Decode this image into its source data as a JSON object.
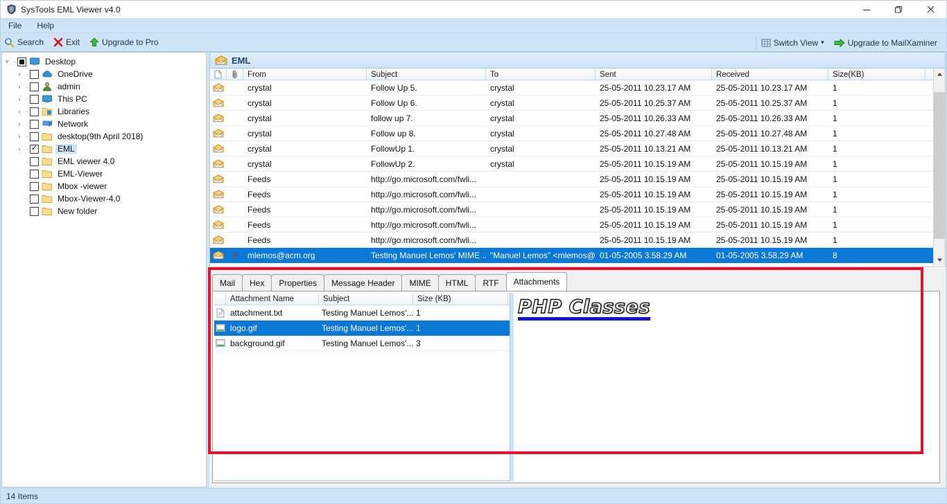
{
  "window": {
    "title": "SysTools EML Viewer v4.0",
    "app_icon": "shield-icon",
    "minimize": "—",
    "maximize": "❐",
    "close": "✕"
  },
  "menubar": {
    "items": [
      {
        "label": "File"
      },
      {
        "label": "Help"
      }
    ]
  },
  "toolbar": {
    "left": [
      {
        "label": "Search",
        "icon": "search-icon"
      },
      {
        "label": "Exit",
        "icon": "close-x-icon"
      },
      {
        "label": "Upgrade to Pro",
        "icon": "green-up-arrow-icon"
      }
    ],
    "right": [
      {
        "label": "Switch View",
        "icon": "grid-icon",
        "caret": "▾"
      },
      {
        "label": "Upgrade to MailXaminer",
        "icon": "green-right-arrow-icon"
      }
    ]
  },
  "sidebar": {
    "items": [
      {
        "label": "Desktop",
        "indent": 0,
        "twist": "˅",
        "check": "square",
        "icon": "monitor-icon",
        "selected": false
      },
      {
        "label": "OneDrive",
        "indent": 1,
        "twist": "›",
        "check": "empty",
        "icon": "cloud-icon",
        "selected": false
      },
      {
        "label": "admin",
        "indent": 1,
        "twist": "›",
        "check": "empty",
        "icon": "user-icon",
        "selected": false
      },
      {
        "label": "This PC",
        "indent": 1,
        "twist": "›",
        "check": "empty",
        "icon": "monitor-icon",
        "selected": false
      },
      {
        "label": "Libraries",
        "indent": 1,
        "twist": "›",
        "check": "empty",
        "icon": "library-icon",
        "selected": false
      },
      {
        "label": "Network",
        "indent": 1,
        "twist": "›",
        "check": "empty",
        "icon": "network-icon",
        "selected": false
      },
      {
        "label": "desktop(9th April 2018)",
        "indent": 1,
        "twist": "›",
        "check": "empty",
        "icon": "folder-icon",
        "selected": false
      },
      {
        "label": "EML",
        "indent": 1,
        "twist": "›",
        "check": "checked",
        "icon": "folder-icon",
        "selected": true
      },
      {
        "label": "EML viewer 4.0",
        "indent": 1,
        "twist": "",
        "check": "empty",
        "icon": "folder-icon",
        "selected": false
      },
      {
        "label": "EML-Viewer",
        "indent": 1,
        "twist": "",
        "check": "empty",
        "icon": "folder-icon",
        "selected": false
      },
      {
        "label": "Mbox -viewer",
        "indent": 1,
        "twist": "",
        "check": "empty",
        "icon": "folder-icon",
        "selected": false
      },
      {
        "label": "Mbox-Viewer-4.0",
        "indent": 1,
        "twist": "",
        "check": "empty",
        "icon": "folder-icon",
        "selected": false
      },
      {
        "label": "New folder",
        "indent": 1,
        "twist": "",
        "check": "empty",
        "icon": "folder-icon",
        "selected": false
      }
    ]
  },
  "folder_header": {
    "title": "EML",
    "icon": "mail-folder-icon"
  },
  "message_list": {
    "columns": [
      {
        "key": "icon",
        "label": ""
      },
      {
        "key": "clip",
        "label": ""
      },
      {
        "key": "from",
        "label": "From"
      },
      {
        "key": "subject",
        "label": "Subject"
      },
      {
        "key": "to",
        "label": "To"
      },
      {
        "key": "sent",
        "label": "Sent"
      },
      {
        "key": "received",
        "label": "Received"
      },
      {
        "key": "size",
        "label": "Size(KB)"
      }
    ],
    "rows": [
      {
        "from": "crystal",
        "subject": "Follow Up 5.",
        "to": "crystal",
        "sent": "25-05-2011 10.23.17 AM",
        "received": "25-05-2011 10.23.17 AM",
        "size": "1",
        "attachment": false,
        "selected": false
      },
      {
        "from": "crystal",
        "subject": "Follow Up 6.",
        "to": "crystal",
        "sent": "25-05-2011 10.25.37 AM",
        "received": "25-05-2011 10.25.37 AM",
        "size": "1",
        "attachment": false,
        "selected": false
      },
      {
        "from": "crystal",
        "subject": "follow up 7.",
        "to": "crystal",
        "sent": "25-05-2011 10.26.33 AM",
        "received": "25-05-2011 10.26.33 AM",
        "size": "1",
        "attachment": false,
        "selected": false
      },
      {
        "from": "crystal",
        "subject": "Follow up 8.",
        "to": "crystal",
        "sent": "25-05-2011 10.27.48 AM",
        "received": "25-05-2011 10.27.48 AM",
        "size": "1",
        "attachment": false,
        "selected": false
      },
      {
        "from": "crystal",
        "subject": "FollowUp 1.",
        "to": "crystal",
        "sent": "25-05-2011 10.13.21 AM",
        "received": "25-05-2011 10.13.21 AM",
        "size": "1",
        "attachment": false,
        "selected": false
      },
      {
        "from": "crystal",
        "subject": "FollowUp 2.",
        "to": "crystal",
        "sent": "25-05-2011 10.15.19 AM",
        "received": "25-05-2011 10.15.19 AM",
        "size": "1",
        "attachment": false,
        "selected": false
      },
      {
        "from": "Feeds",
        "subject": "http://go.microsoft.com/fwli...",
        "to": "",
        "sent": "25-05-2011 10.15.19 AM",
        "received": "25-05-2011 10.15.19 AM",
        "size": "1",
        "attachment": false,
        "selected": false
      },
      {
        "from": "Feeds",
        "subject": "http://go.microsoft.com/fwli...",
        "to": "",
        "sent": "25-05-2011 10.15.19 AM",
        "received": "25-05-2011 10.15.19 AM",
        "size": "1",
        "attachment": false,
        "selected": false
      },
      {
        "from": "Feeds",
        "subject": "http://go.microsoft.com/fwli...",
        "to": "",
        "sent": "25-05-2011 10.15.19 AM",
        "received": "25-05-2011 10.15.19 AM",
        "size": "1",
        "attachment": false,
        "selected": false
      },
      {
        "from": "Feeds",
        "subject": "http://go.microsoft.com/fwli...",
        "to": "",
        "sent": "25-05-2011 10.15.19 AM",
        "received": "25-05-2011 10.15.19 AM",
        "size": "1",
        "attachment": false,
        "selected": false
      },
      {
        "from": "Feeds",
        "subject": "http://go.microsoft.com/fwli...",
        "to": "",
        "sent": "25-05-2011 10.15.19 AM",
        "received": "25-05-2011 10.15.19 AM",
        "size": "1",
        "attachment": false,
        "selected": false
      },
      {
        "from": "mlemos@acm.org",
        "subject": "Testing Manuel Lemos' MIME ...",
        "to": "\"Manuel Lemos\" <mlemos@li...",
        "sent": "01-05-2005 3.58.29 AM",
        "received": "01-05-2005 3.58.29 AM",
        "size": "8",
        "attachment": true,
        "selected": true
      }
    ]
  },
  "tabs": [
    {
      "label": "Mail",
      "active": false
    },
    {
      "label": "Hex",
      "active": false
    },
    {
      "label": "Properties",
      "active": false
    },
    {
      "label": "Message Header",
      "active": false
    },
    {
      "label": "MIME",
      "active": false
    },
    {
      "label": "HTML",
      "active": false
    },
    {
      "label": "RTF",
      "active": false
    },
    {
      "label": "Attachments",
      "active": true
    }
  ],
  "attachments": {
    "columns": [
      {
        "key": "icon",
        "label": ""
      },
      {
        "key": "name",
        "label": "Attachment Name"
      },
      {
        "key": "subject",
        "label": "Subject"
      },
      {
        "key": "size",
        "label": "Size (KB)"
      }
    ],
    "rows": [
      {
        "name": "attachment.txt",
        "subject": "Testing Manuel Lemos'...",
        "size": "1",
        "icon": "text-file-icon",
        "selected": false
      },
      {
        "name": "logo.gif",
        "subject": "Testing Manuel Lemos'...",
        "size": "1",
        "icon": "image-file-icon",
        "selected": true
      },
      {
        "name": "background.gif",
        "subject": "Testing Manuel Lemos'...",
        "size": "3",
        "icon": "image-file-icon",
        "selected": false
      }
    ]
  },
  "preview": {
    "logo_text": "PHP Classes"
  },
  "status_bar": {
    "text": "14 Items"
  },
  "colors": {
    "chrome": "#cfe3f7",
    "selection": "#0a78d4",
    "annotation": "#e8112d",
    "accent_text": "#16334f",
    "logo_bar": "#1515d8"
  }
}
